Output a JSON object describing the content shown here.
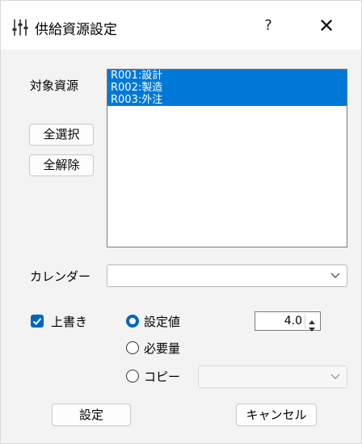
{
  "window": {
    "title": "供給資源設定",
    "help_glyph": "?",
    "close_glyph": "✕"
  },
  "resources": {
    "label": "対象資源",
    "items": [
      "R001:設計",
      "R002:製造",
      "R003:外注"
    ],
    "select_all_label": "全選択",
    "deselect_all_label": "全解除"
  },
  "calendar": {
    "label": "カレンダー",
    "value": ""
  },
  "overwrite": {
    "label": "上書き",
    "checked": true
  },
  "mode": {
    "options": [
      "設定値",
      "必要量",
      "コピー"
    ],
    "selected": "設定値"
  },
  "setting_value": "4.0",
  "copy_source": {
    "value": "",
    "disabled": true
  },
  "footer": {
    "ok_label": "設定",
    "cancel_label": "キャンセル"
  },
  "colors": {
    "accent": "#0067c0",
    "selection": "#0078d7"
  }
}
